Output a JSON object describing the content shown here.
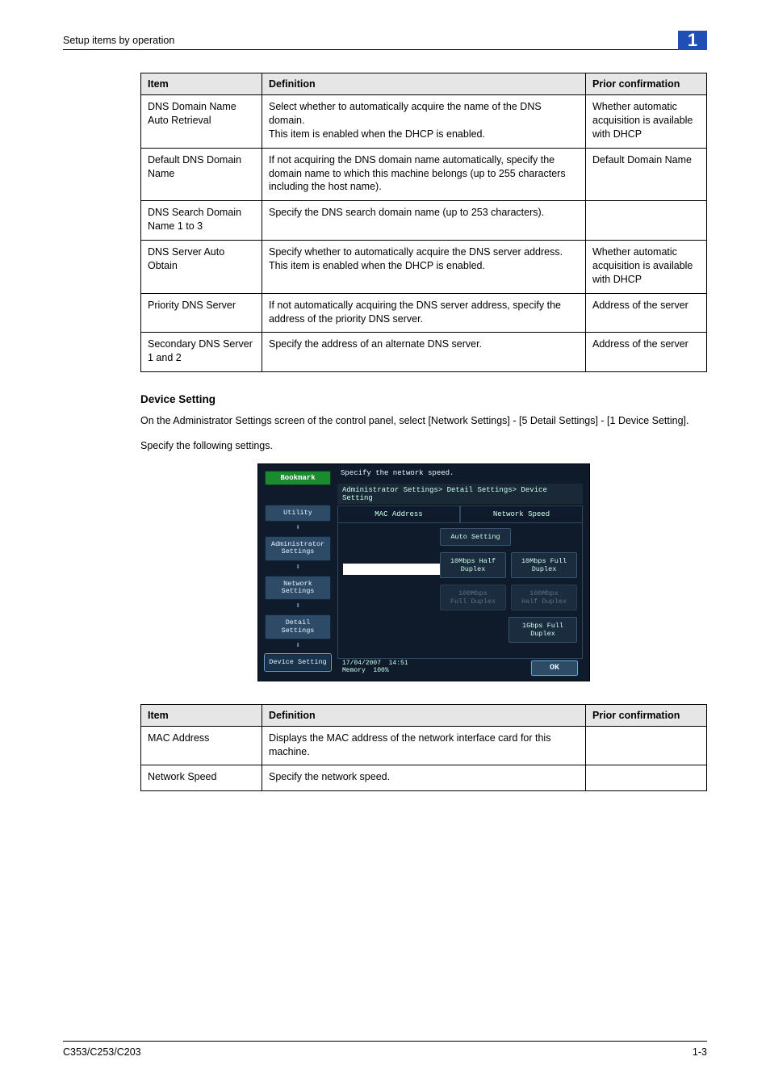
{
  "header": {
    "breadcrumb": "Setup items by operation",
    "chapter_number": "1"
  },
  "table1": {
    "headers": {
      "item": "Item",
      "definition": "Definition",
      "prior": "Prior confirmation"
    },
    "rows": [
      {
        "item": "DNS Domain Name Auto Retrieval",
        "definition": "Select whether to automatically acquire the name of the DNS domain.\nThis item is enabled when the DHCP is enabled.",
        "prior": "Whether automatic acquisition is available with DHCP"
      },
      {
        "item": "Default DNS Domain Name",
        "definition": "If not acquiring the DNS domain name automatically, specify the domain name to which this machine belongs (up to 255 characters including the host name).",
        "prior": "Default Domain Name"
      },
      {
        "item": "DNS Search Domain Name 1 to 3",
        "definition": "Specify the DNS search domain name (up to 253 characters).",
        "prior": ""
      },
      {
        "item": "DNS Server Auto Obtain",
        "definition": "Specify whether to automatically acquire the DNS server address.\nThis item is enabled when the DHCP is enabled.",
        "prior": "Whether automatic acquisition is available with DHCP"
      },
      {
        "item": "Priority DNS Server",
        "definition": "If not automatically acquiring the DNS server address, specify the address of the priority DNS server.",
        "prior": "Address of the server"
      },
      {
        "item": "Secondary DNS Server 1 and 2",
        "definition": "Specify the address of an alternate DNS server.",
        "prior": "Address of the server"
      }
    ]
  },
  "section": {
    "title": "Device Setting",
    "para1": "On the Administrator Settings screen of the control panel, select [Network Settings] - [5 Detail Settings] - [1 Device Setting].",
    "para2": "Specify the following settings."
  },
  "panel": {
    "instruction": "Specify the network speed.",
    "bookmark": "Bookmark",
    "breadcrumb": "Administrator Settings> Detail Settings> Device Setting",
    "nav": [
      "Utility",
      "Administrator\nSettings",
      "Network\nSettings",
      "Detail\nSettings",
      "Device Setting"
    ],
    "tabs": {
      "mac": "MAC Address",
      "speed": "Network Speed"
    },
    "speed_buttons": {
      "auto": "Auto Setting",
      "half10": "10Mbps Half Duplex",
      "full10": "10Mbps Full Duplex",
      "full100": "100Mbps\nFull Duplex",
      "half100": "100Mbps\nHalf Duplex",
      "g1": "1Gbps Full Duplex"
    },
    "footer": {
      "date": "17/04/2007",
      "time": "14:51",
      "mem_label": "Memory",
      "mem_val": "100%",
      "ok": "OK"
    }
  },
  "table2": {
    "headers": {
      "item": "Item",
      "definition": "Definition",
      "prior": "Prior confirmation"
    },
    "rows": [
      {
        "item": "MAC Address",
        "definition": "Displays the MAC address of the network interface card for this machine.",
        "prior": ""
      },
      {
        "item": "Network Speed",
        "definition": "Specify the network speed.",
        "prior": ""
      }
    ]
  },
  "footer": {
    "model": "C353/C253/C203",
    "page": "1-3"
  }
}
